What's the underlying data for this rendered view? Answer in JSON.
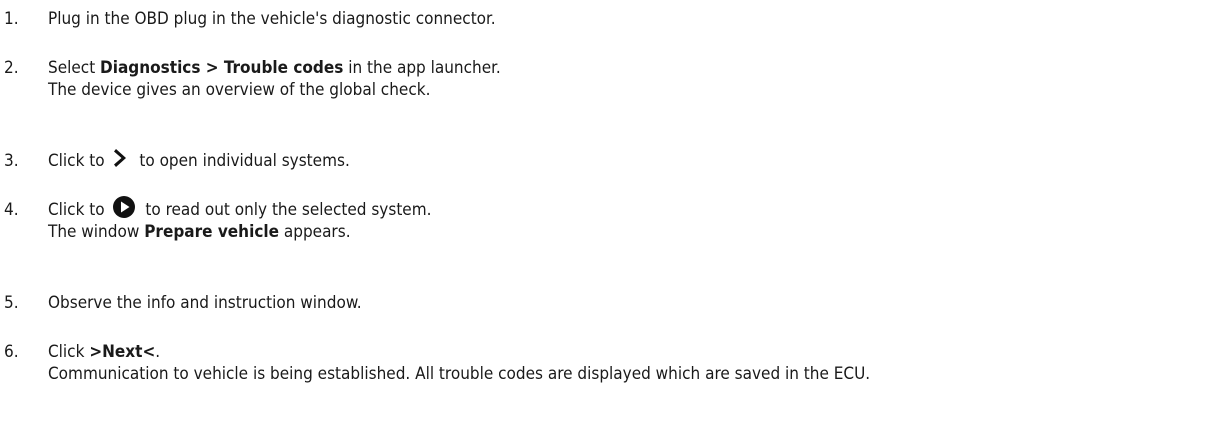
{
  "steps": [
    {
      "number": "1.",
      "text": "Plug in the OBD plug in the vehicle's diagnostic connector."
    },
    {
      "number": "2.",
      "pre": "Select ",
      "bold": "Diagnostics > Trouble codes",
      "post": " in the app launcher.",
      "result": "The device gives an overview of the global check."
    },
    {
      "number": "3.",
      "pre": "Click to ",
      "icon": "chevron-right-icon",
      "post": " to open individual systems."
    },
    {
      "number": "4.",
      "pre": "Click to ",
      "icon": "play-circle-icon",
      "post": " to read out only the selected system.",
      "result_pre": "The window ",
      "result_bold": "Prepare vehicle",
      "result_post": " appears."
    },
    {
      "number": "5.",
      "text": "Observe the info and instruction window."
    },
    {
      "number": "6.",
      "pre": "Click ",
      "bold": ">Next<",
      "post": ".",
      "result": "Communication to vehicle is being established. All trouble codes are displayed which are saved in the ECU."
    }
  ]
}
